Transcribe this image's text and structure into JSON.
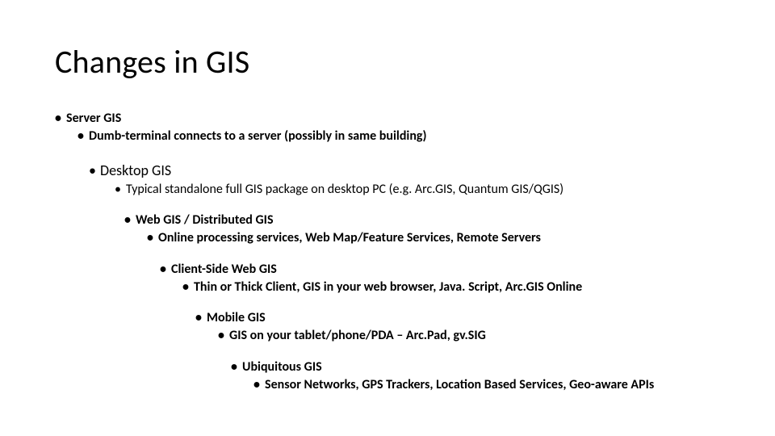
{
  "title": "Changes in GIS",
  "outline": {
    "server": {
      "label": "Server GIS",
      "desc": "Dumb-terminal connects to a server (possibly in same building)"
    },
    "desktop": {
      "label": "Desktop GIS",
      "desc": "Typical standalone full GIS package on desktop PC (e.g. Arc.GIS, Quantum GIS/QGIS)"
    },
    "web": {
      "label": "Web GIS / Distributed GIS",
      "desc": "Online processing services, Web Map/Feature Services, Remote Servers"
    },
    "client": {
      "label": "Client-Side Web GIS",
      "desc": "Thin or Thick Client, GIS in your web browser, Java. Script, Arc.GIS Online"
    },
    "mobile": {
      "label": "Mobile GIS",
      "desc": "GIS on your tablet/phone/PDA – Arc.Pad, gv.SIG"
    },
    "ubiq": {
      "label": "Ubiquitous GIS",
      "desc": "Sensor Networks, GPS Trackers, Location Based Services, Geo-aware APIs"
    }
  }
}
